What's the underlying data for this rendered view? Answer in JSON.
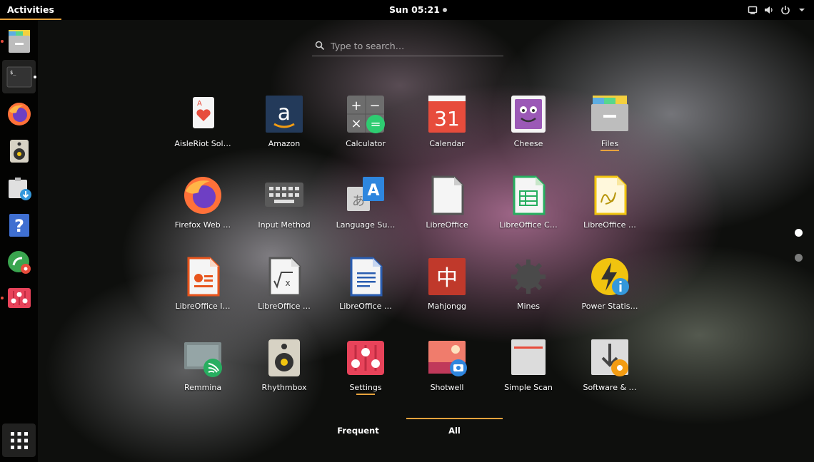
{
  "topbar": {
    "activities": "Activities",
    "clock": "Sun 05:21"
  },
  "search": {
    "placeholder": "Type to search…"
  },
  "dock": {
    "items": [
      "files",
      "terminal",
      "firefox",
      "rhythmbox",
      "software-install",
      "help",
      "system-tools",
      "settings"
    ]
  },
  "apps": [
    {
      "label": "AisleRiot Sol…",
      "icon": "cards-icon"
    },
    {
      "label": "Amazon",
      "icon": "amazon-icon"
    },
    {
      "label": "Calculator",
      "icon": "calculator-icon"
    },
    {
      "label": "Calendar",
      "icon": "calendar-icon",
      "day": "31"
    },
    {
      "label": "Cheese",
      "icon": "cheese-icon"
    },
    {
      "label": "Files",
      "icon": "files-icon",
      "running": true
    },
    {
      "label": "Firefox Web …",
      "icon": "firefox-icon"
    },
    {
      "label": "Input Method",
      "icon": "keyboard-icon"
    },
    {
      "label": "Language Su…",
      "icon": "language-icon"
    },
    {
      "label": "LibreOffice",
      "icon": "libreoffice-icon"
    },
    {
      "label": "LibreOffice C…",
      "icon": "calc-icon"
    },
    {
      "label": "LibreOffice …",
      "icon": "draw-icon"
    },
    {
      "label": "LibreOffice I…",
      "icon": "impress-icon"
    },
    {
      "label": "LibreOffice …",
      "icon": "math-icon"
    },
    {
      "label": "LibreOffice …",
      "icon": "writer-icon"
    },
    {
      "label": "Mahjongg",
      "icon": "mahjongg-icon"
    },
    {
      "label": "Mines",
      "icon": "mines-icon"
    },
    {
      "label": "Power Statis…",
      "icon": "power-stats-icon"
    },
    {
      "label": "Remmina",
      "icon": "remmina-icon"
    },
    {
      "label": "Rhythmbox",
      "icon": "rhythmbox-icon"
    },
    {
      "label": "Settings",
      "icon": "settings-icon",
      "running": true
    },
    {
      "label": "Shotwell",
      "icon": "shotwell-icon"
    },
    {
      "label": "Simple Scan",
      "icon": "scanner-icon"
    },
    {
      "label": "Software & …",
      "icon": "software-updates-icon"
    }
  ],
  "tabs": {
    "frequent": "Frequent",
    "all": "All"
  },
  "pages": {
    "current": 1,
    "total": 2
  },
  "colors": {
    "accent": "#e8a33d"
  }
}
